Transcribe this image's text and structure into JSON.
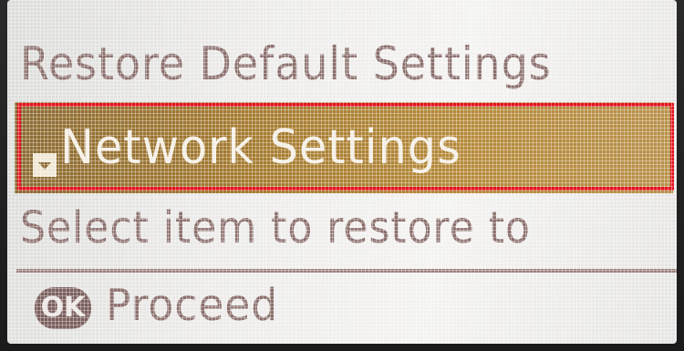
{
  "screen": {
    "title": "Restore Default Settings",
    "selected_item": {
      "label": "Network Settings",
      "icon": "down-arrow-icon",
      "highlight_color": "#a47a2e"
    },
    "hint": "Select item to restore to",
    "ok_button": {
      "label": "OK",
      "icon": "ok-button-icon"
    },
    "action_label": "Proceed",
    "annotation_color": "#e3101b"
  }
}
